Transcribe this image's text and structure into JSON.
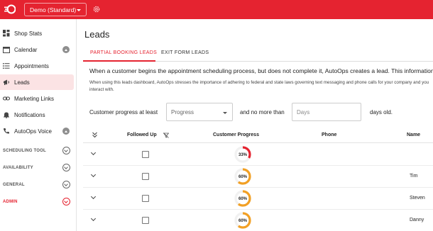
{
  "topbar": {
    "shop_name": "Demo (Standard)",
    "brand_color": "#e52330"
  },
  "sidebar": {
    "items": [
      {
        "label": "Shop Stats",
        "icon": "dashboard-icon"
      },
      {
        "label": "Calendar",
        "icon": "calendar-icon",
        "badge": "up-arrow"
      },
      {
        "label": "Appointments",
        "icon": "list-icon"
      },
      {
        "label": "Leads",
        "icon": "megaphone-icon",
        "active": true
      },
      {
        "label": "Marketing Links",
        "icon": "link-icon"
      },
      {
        "label": "Notifications",
        "icon": "bell-icon"
      },
      {
        "label": "AutoOps Voice",
        "icon": "phone-icon",
        "badge": "up-arrow"
      }
    ],
    "sections": [
      {
        "label": "SCHEDULING TOOL"
      },
      {
        "label": "AVAILABILITY"
      },
      {
        "label": "GENERAL"
      },
      {
        "label": "ADMIN"
      }
    ]
  },
  "main": {
    "title": "Leads",
    "tabs": [
      {
        "label": "PARTIAL BOOKING LEADS",
        "active": true
      },
      {
        "label": "EXIT FORM LEADS",
        "active": false
      }
    ],
    "description": "When a customer begins the appointment scheduling process, but does not complete it, AutoOps creates a lead. This information can b",
    "disclaimer": "When using this leads dashboard, AutoOps stresses the importance of adhering to federal and state laws governing text messaging and phone calls for your company and you interact with.",
    "filter": {
      "label_before": "Customer progress at least",
      "progress_placeholder": "Progress",
      "label_middle": "and no more than",
      "days_placeholder": "Days",
      "label_after": "days old."
    },
    "table": {
      "columns": [
        "Followed Up",
        "Customer Progress",
        "Phone",
        "Name"
      ],
      "rows": [
        {
          "progress_label": "33%",
          "progress": 0.33,
          "color": "#e52330",
          "phone": "",
          "name": ""
        },
        {
          "progress_label": "60%",
          "progress": 0.6,
          "color": "#f2a024",
          "phone": "",
          "name": "Tim"
        },
        {
          "progress_label": "60%",
          "progress": 0.6,
          "color": "#f2a024",
          "phone": "",
          "name": "Steven"
        },
        {
          "progress_label": "60%",
          "progress": 0.6,
          "color": "#f2a024",
          "phone": "",
          "name": "Danny"
        }
      ]
    }
  }
}
